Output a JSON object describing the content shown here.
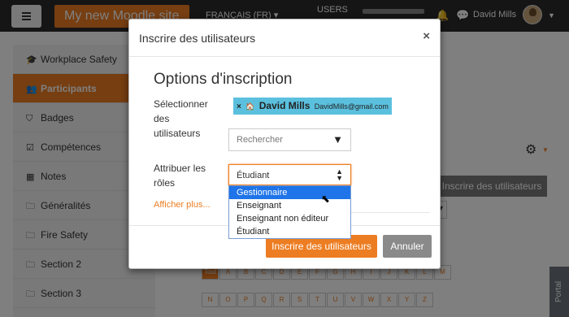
{
  "navbar": {
    "site_name": "My new Moodle site",
    "language": "FRANÇAIS (FR) ▾",
    "users_label": "USERS",
    "user_name": "David Mills",
    "bell_icon": "bell-icon",
    "chat_icon": "chat-icon"
  },
  "sidebar": {
    "items": [
      {
        "label": "Workplace Safety",
        "icon": "graduation-cap-icon"
      },
      {
        "label": "Participants",
        "icon": "users-icon",
        "active": true
      },
      {
        "label": "Badges",
        "icon": "shield-icon"
      },
      {
        "label": "Compétences",
        "icon": "checkbox-icon"
      },
      {
        "label": "Notes",
        "icon": "table-icon"
      },
      {
        "label": "Généralités",
        "icon": "folder-icon"
      },
      {
        "label": "Fire Safety",
        "icon": "folder-icon"
      },
      {
        "label": "Section 2",
        "icon": "folder-icon"
      },
      {
        "label": "Section 3",
        "icon": "folder-icon"
      }
    ]
  },
  "background": {
    "enrol_button": "Inscrire des utilisateurs",
    "letters_row1": [
      "Tout",
      "A",
      "B",
      "C",
      "D",
      "E",
      "F",
      "G",
      "H",
      "I",
      "J",
      "K",
      "L",
      "M"
    ],
    "letters_row2": [
      "N",
      "O",
      "P",
      "Q",
      "R",
      "S",
      "T",
      "U",
      "V",
      "W",
      "X",
      "Y",
      "Z"
    ],
    "portal_tab": "Portal"
  },
  "modal": {
    "title": "Inscrire des utilisateurs",
    "close": "×",
    "section_title": "Options d'inscription",
    "select_users_label": "Sélectionner des utilisateurs",
    "selected_user": {
      "name": "David Mills",
      "email": "DavidMills@gmail.com",
      "remove": "×"
    },
    "search_placeholder": "Rechercher",
    "assign_roles_label": "Attribuer les rôles",
    "role_selected": "Étudiant",
    "role_options": [
      "Gestionnaire",
      "Enseignant",
      "Enseignant non éditeur",
      "Étudiant"
    ],
    "highlighted_option": "Gestionnaire",
    "show_more": "Afficher plus...",
    "submit_button": "Inscrire des utilisateurs",
    "cancel_button": "Annuler"
  },
  "colors": {
    "accent": "#ed7d22",
    "chip": "#5bc0de",
    "highlight": "#1e74e8",
    "navbar": "#2a2a2a"
  }
}
